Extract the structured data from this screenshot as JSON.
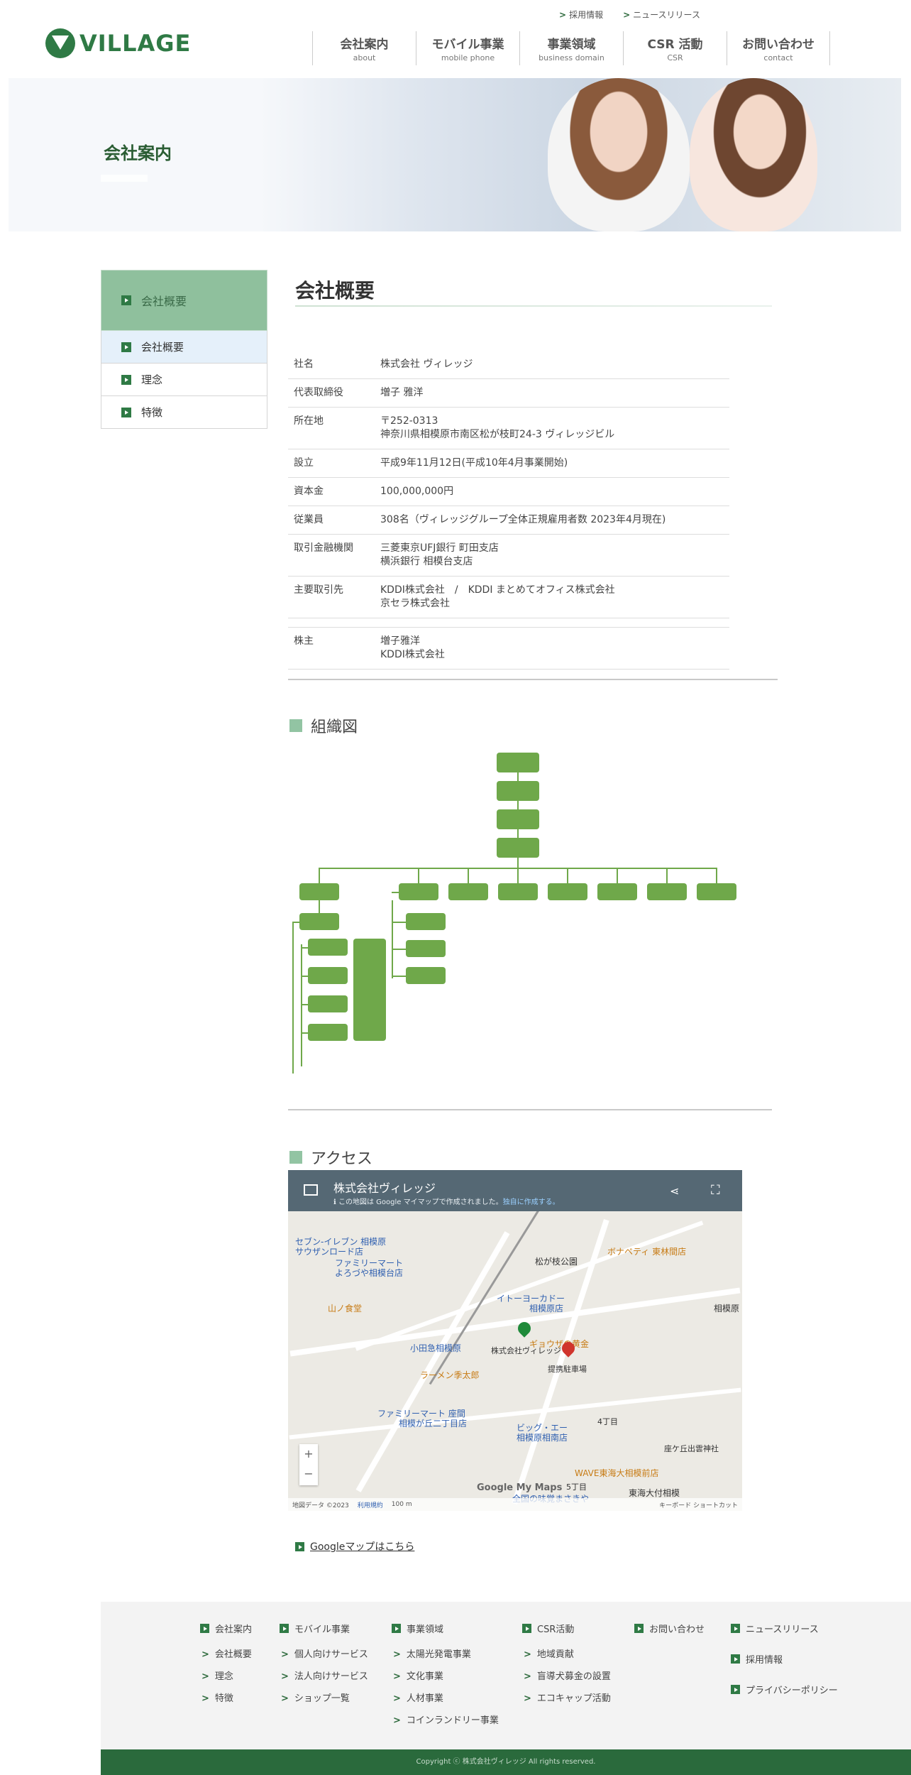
{
  "header": {
    "top_links": [
      "採用情報",
      "ニュースリリース"
    ],
    "logo_text": "VILLAGE",
    "nav": [
      {
        "jp": "会社案内",
        "en": "about"
      },
      {
        "jp": "モバイル事業",
        "en": "mobile phone"
      },
      {
        "jp": "事業領域",
        "en": "business domain"
      },
      {
        "jp": "CSR 活動",
        "en": "CSR"
      },
      {
        "jp": "お問い合わせ",
        "en": "contact"
      }
    ]
  },
  "hero": {
    "title": "会社案内"
  },
  "sidebar": {
    "head": "会社概要",
    "items": [
      "会社概要",
      "理念",
      "特徴"
    ]
  },
  "main": {
    "title": "会社概要",
    "rows": [
      {
        "label": "社名",
        "lines": [
          "株式会社 ヴィレッジ"
        ]
      },
      {
        "label": "代表取締役",
        "lines": [
          "増子 雅洋"
        ]
      },
      {
        "label": "所在地",
        "lines": [
          "〒252-0313",
          "神奈川県相模原市南区松が枝町24-3 ヴィレッジビル"
        ]
      },
      {
        "label": "設立",
        "lines": [
          "平成9年11月12日(平成10年4月事業開始)"
        ]
      },
      {
        "label": "資本金",
        "lines": [
          "100,000,000円"
        ]
      },
      {
        "label": "従業員",
        "lines": [
          "308名（ヴィレッジグループ全体正規雇用者数 2023年4月現在)"
        ]
      },
      {
        "label": "取引金融機関",
        "lines": [
          "三菱東京UFJ銀行 町田支店",
          "横浜銀行 相模台支店"
        ]
      },
      {
        "label": "主要取引先",
        "lines": [
          "KDDI株式会社　/　KDDI まとめてオフィス株式会社",
          "京セラ株式会社"
        ]
      },
      {
        "label": "",
        "lines": [
          ""
        ]
      },
      {
        "label": "株主",
        "lines": [
          "増子雅洋",
          "KDDI株式会社"
        ]
      }
    ]
  },
  "org": {
    "title": "組織図"
  },
  "access": {
    "title": "アクセス",
    "map": {
      "name": "株式会社ヴィレッジ",
      "subtitle": "この地図は Google マイマップで作成されました。",
      "subtitle_link": "独自に作成する。",
      "pois": [
        {
          "text": "セブン-イレブン 相模原",
          "cls": "blue"
        },
        {
          "text": "サウザンロード店",
          "cls": "blue"
        },
        {
          "text": "ファミリーマート",
          "cls": "blue"
        },
        {
          "text": "よろづや相模台店",
          "cls": "blue"
        },
        {
          "text": "松が枝公園",
          "cls": "dark"
        },
        {
          "text": "ボナペティ 東林間店",
          "cls": "orange"
        },
        {
          "text": "山ノ食堂",
          "cls": "orange"
        },
        {
          "text": "イトーヨーカドー",
          "cls": "blue"
        },
        {
          "text": "相模原店",
          "cls": "blue"
        },
        {
          "text": "小田急相模原",
          "cls": "blue"
        },
        {
          "text": "株式会社ヴィレッジ",
          "cls": "dark"
        },
        {
          "text": "ギョウザの黄金",
          "cls": "orange"
        },
        {
          "text": "提携駐車場",
          "cls": "dark"
        },
        {
          "text": "ラーメン季太郎",
          "cls": "orange"
        },
        {
          "text": "ファミリーマート 座間",
          "cls": "blue"
        },
        {
          "text": "相模が丘二丁目店",
          "cls": "blue"
        },
        {
          "text": "ビッグ・エー",
          "cls": "blue"
        },
        {
          "text": "相模原相南店",
          "cls": "blue"
        },
        {
          "text": "4丁目",
          "cls": "dark"
        },
        {
          "text": "座ケ丘出雲神社",
          "cls": "dark"
        },
        {
          "text": "WAVE東海大相模前店",
          "cls": "orange"
        },
        {
          "text": "全国の味覚まさきや",
          "cls": "blue"
        },
        {
          "text": "5丁目",
          "cls": "dark"
        },
        {
          "text": "東海大付相模",
          "cls": "dark"
        },
        {
          "text": "相模原",
          "cls": "dark"
        }
      ],
      "footer": [
        "地図データ ©2023",
        "利用規約",
        "100 m",
        "キーボード ショートカット"
      ],
      "logo": "Google My Maps",
      "zoom_in": "+",
      "zoom_out": "−"
    },
    "link": "Googleマップはこちら"
  },
  "footer": {
    "columns": [
      {
        "head": "会社案内",
        "subs": [
          "会社概要",
          "理念",
          "特徴"
        ]
      },
      {
        "head": "モバイル事業",
        "subs": [
          "個人向けサービス",
          "法人向けサービス",
          "ショップ一覧"
        ]
      },
      {
        "head": "事業領域",
        "subs": [
          "太陽光発電事業",
          "文化事業",
          "人材事業",
          "コインランドリー事業"
        ]
      },
      {
        "head": "CSR活動",
        "subs": [
          "地域貢献",
          "盲導犬募金の設置",
          "エコキャップ活動"
        ]
      },
      {
        "head": "お問い合わせ",
        "subs": []
      },
      {
        "head": "ニュースリリース",
        "subs": []
      }
    ],
    "extra": [
      "採用情報",
      "プライバシーポリシー"
    ],
    "copyright": "Copyright ⓒ 株式会社ヴィレッジ All rights reserved."
  },
  "colors": {
    "brand": "#2f7a45",
    "accent": "#8fc09d",
    "org_box": "#6fa84a",
    "footer_bar": "#2a6a3c"
  }
}
